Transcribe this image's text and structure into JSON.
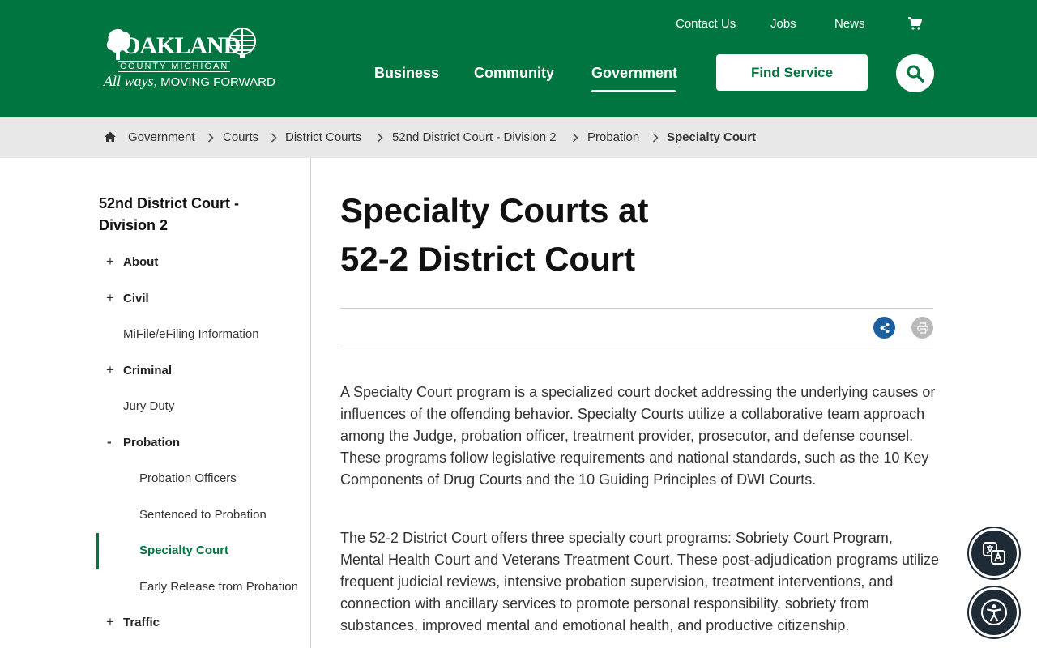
{
  "logo": {
    "word": "OAKLAND",
    "sub": "COUNTY MICHIGAN",
    "tag_italic": "All ways,",
    "tag_rest": " MOVING FORWARD"
  },
  "utility_nav": {
    "contact": "Contact Us",
    "jobs": "Jobs",
    "news": "News"
  },
  "main_nav": {
    "business": "Business",
    "community": "Community",
    "government": "Government",
    "active": "Government"
  },
  "find_service": "Find Service",
  "breadcrumb": [
    "Government",
    "Courts",
    "District Courts",
    "52nd District Court - Division 2",
    "Probation",
    "Specialty Court"
  ],
  "sidebar": {
    "title": "52nd District Court - Division 2",
    "items": [
      {
        "label": "About",
        "sign": "+"
      },
      {
        "label": "Civil",
        "sign": "+"
      },
      {
        "label": "MiFile/eFiling Information",
        "sign": ""
      },
      {
        "label": "Criminal",
        "sign": "+"
      },
      {
        "label": "Jury Duty",
        "sign": ""
      },
      {
        "label": "Probation",
        "sign": "-"
      },
      {
        "label": "Probation Officers",
        "sign": ""
      },
      {
        "label": "Sentenced to Probation",
        "sign": ""
      },
      {
        "label": "Specialty Court",
        "sign": "",
        "active": true
      },
      {
        "label": "Early Release from Probation",
        "sign": ""
      },
      {
        "label": "Traffic",
        "sign": "+"
      }
    ]
  },
  "main": {
    "title_line1": "Specialty Courts at",
    "title_line2": "52-2 District Court",
    "paragraphs": [
      "A Specialty Court program is a specialized court docket addressing the underlying causes or influences of the offending behavior. Specialty Courts utilize a collaborative team approach among the Judge, probation officer, treatment provider, prosecutor, and defense counsel. These programs follow legislative requirements and national standards, such as the 10 Key Components of Drug Courts and the 10 Guiding Principles of DWI Courts.",
      "The 52-2 District Court offers three specialty court programs: Sobriety Court Program, Mental Health Court and Veterans Treatment Court. These post-adjudication programs utilize frequent judicial reviews, intensive probation supervision, treatment interventions, and connection with ancillary services to promote personal responsibility, sobriety from substances, improved mental and emotional health, and productive citizenship."
    ]
  },
  "colors": {
    "brand_green": "#00753f",
    "share_blue": "#1a5fa0",
    "float_dark": "#1f2a37"
  },
  "icons": [
    "home-icon",
    "chevron-right-icon",
    "cart-icon",
    "search-icon",
    "share-icon",
    "print-icon",
    "translate-icon",
    "accessibility-icon"
  ]
}
